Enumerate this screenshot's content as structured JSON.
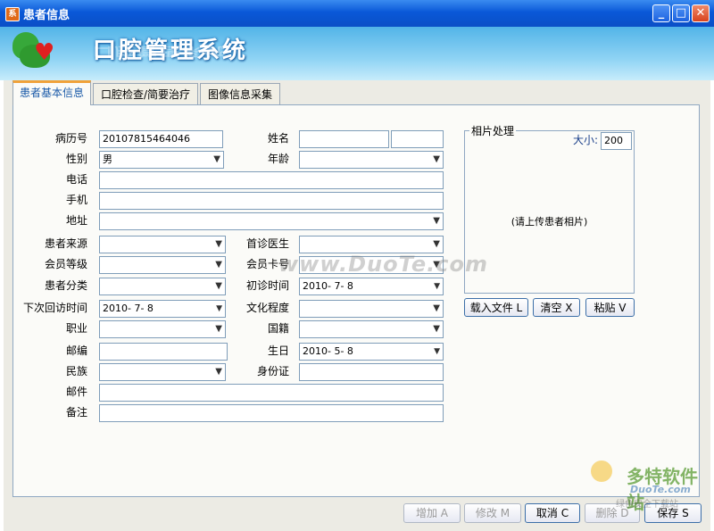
{
  "window": {
    "title": "患者信息",
    "app_icon": "系"
  },
  "banner": {
    "title": "口腔管理系统"
  },
  "tabs": [
    "患者基本信息",
    "口腔检查/简要治疗",
    "图像信息采集"
  ],
  "form": {
    "record_no": {
      "label": "病历号",
      "value": "20107815464046"
    },
    "name": {
      "label": "姓名",
      "value": ""
    },
    "gender": {
      "label": "性别",
      "value": "男"
    },
    "age": {
      "label": "年龄",
      "value": ""
    },
    "phone": {
      "label": "电话",
      "value": ""
    },
    "mobile": {
      "label": "手机",
      "value": ""
    },
    "address": {
      "label": "地址",
      "value": ""
    },
    "source": {
      "label": "患者来源",
      "value": ""
    },
    "first_doctor": {
      "label": "首诊医生",
      "value": ""
    },
    "member_level": {
      "label": "会员等级",
      "value": ""
    },
    "member_card": {
      "label": "会员卡号",
      "value": ""
    },
    "category": {
      "label": "患者分类",
      "value": ""
    },
    "first_visit": {
      "label": "初诊时间",
      "value": "2010- 7- 8"
    },
    "next_visit": {
      "label": "下次回访时间",
      "value": "2010- 7- 8"
    },
    "education": {
      "label": "文化程度",
      "value": ""
    },
    "occupation": {
      "label": "职业",
      "value": ""
    },
    "nationality": {
      "label": "国籍",
      "value": ""
    },
    "postcode": {
      "label": "邮编",
      "value": ""
    },
    "birthday": {
      "label": "生日",
      "value": "2010- 5- 8"
    },
    "ethnicity": {
      "label": "民族",
      "value": ""
    },
    "id_card": {
      "label": "身份证",
      "value": ""
    },
    "email": {
      "label": "邮件",
      "value": ""
    },
    "remarks": {
      "label": "备注",
      "value": ""
    }
  },
  "photo": {
    "legend": "相片处理",
    "size_label": "大小:",
    "size_value": "200",
    "placeholder": "(请上传患者相片)",
    "load_button": "载入文件 L",
    "clear_button": "清空 X",
    "paste_button": "粘贴 V"
  },
  "footer": {
    "add": "增加 A",
    "modify": "修改 M",
    "cancel": "取消 C",
    "delete": "删除 D",
    "save": "保存 S"
  },
  "watermark": {
    "center": "www.DuoTe.com",
    "corner_logo": "多特软件站",
    "corner_url": "DuoTe.com",
    "corner_sub": "绿色安全下载站"
  }
}
